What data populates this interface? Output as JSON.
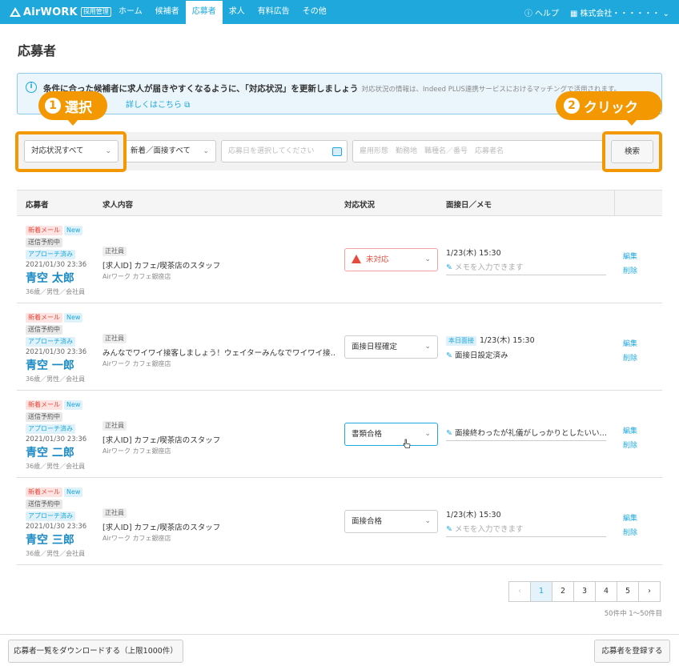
{
  "header": {
    "logo_text": "AirWORK",
    "logo_badge": "採用管理",
    "nav": [
      {
        "label": "ホーム",
        "active": false
      },
      {
        "label": "候補者",
        "active": false
      },
      {
        "label": "応募者",
        "active": true
      },
      {
        "label": "求人",
        "active": false
      },
      {
        "label": "有料広告",
        "active": false
      },
      {
        "label": "その他",
        "active": false
      }
    ],
    "help_label": "ヘルプ",
    "company_label": "株式会社・・・・・・"
  },
  "page_title": "応募者",
  "banner": {
    "text": "条件に合った候補者に求人が届きやすくなるように、「対応状況」を更新しましょう",
    "sub": "対応状況の情報は、Indeed PLUS連携サービスにおけるマッチングで活用されます。",
    "link": "詳しくはこちら"
  },
  "callouts": {
    "select": {
      "num": "1",
      "label": "選択"
    },
    "click": {
      "num": "2",
      "label": "クリック"
    }
  },
  "filters": {
    "status": "対応状況すべて",
    "newflag": "新着／面接すべて",
    "date_placeholder": "応募日を選択してください",
    "keyword_placeholder": "雇用形態　勤務地　職種名／番号　応募者名",
    "search_label": "検索"
  },
  "table": {
    "headers": {
      "applicant": "応募者",
      "job": "求人内容",
      "status": "対応状況",
      "memo": "面接日／メモ"
    },
    "rows": [
      {
        "badges": {
          "mail": "新着メール",
          "new": "New",
          "sched": "送信予約中",
          "approach": "アプローチ済み"
        },
        "date": "2021/01/30 23:36",
        "name": "青空 太郎",
        "meta": "36歳／男性／会社員",
        "job_type": "正社員",
        "job_title": "[求人ID] カフェ/喫茶店のスタッフ",
        "job_store": "Airワーク カフェ銀座店",
        "status": "未対応",
        "memo_date": "1/23(木) 15:30",
        "memo": "メモを入力できます",
        "edit": "編集",
        "delete": "削除"
      },
      {
        "badges": {
          "mail": "新着メール",
          "new": "New",
          "sched": "送信予約中",
          "approach": "アプローチ済み"
        },
        "date": "2021/01/30 23:36",
        "name": "青空 一郎",
        "meta": "36歳／男性／会社員",
        "job_type": "正社員",
        "job_title": "みんなでワイワイ接客しましょう！ウェイターみんなでワイワイ接…",
        "job_store": "Airワーク カフェ銀座店",
        "status": "面接日程確定",
        "today": "本日面接",
        "memo_date": "1/23(木) 15:30",
        "memo": "面接日設定済み",
        "edit": "編集",
        "delete": "削除"
      },
      {
        "badges": {
          "mail": "新着メール",
          "new": "New",
          "sched": "送信予約中",
          "approach": "アプローチ済み"
        },
        "date": "2021/01/30 23:36",
        "name": "青空 二郎",
        "meta": "36歳／男性／会社員",
        "job_type": "正社員",
        "job_title": "[求人ID] カフェ/喫茶店のスタッフ",
        "job_store": "Airワーク カフェ銀座店",
        "status": "書類合格",
        "memo": "面接終わったが礼儀がしっかりとしたいい…",
        "edit": "編集",
        "delete": "削除"
      },
      {
        "badges": {
          "mail": "新着メール",
          "new": "New",
          "sched": "送信予約中",
          "approach": "アプローチ済み"
        },
        "date": "2021/01/30 23:36",
        "name": "青空 三郎",
        "meta": "36歳／男性／会社員",
        "job_type": "正社員",
        "job_title": "[求人ID] カフェ/喫茶店のスタッフ",
        "job_store": "Airワーク カフェ銀座店",
        "status": "面接合格",
        "memo_date": "1/23(木) 15:30",
        "memo": "メモを入力できます",
        "edit": "編集",
        "delete": "削除"
      }
    ]
  },
  "pagination": {
    "pages": [
      "1",
      "2",
      "3",
      "4",
      "5"
    ],
    "current": "1",
    "count": "50件中 1〜50件目"
  },
  "footer": {
    "download": "応募者一覧をダウンロードする（上限1000件）",
    "register": "応募者を登録する"
  },
  "colors": {
    "brand": "#1ea8dc",
    "highlight": "#f39800",
    "alert": "#e64a3c"
  }
}
